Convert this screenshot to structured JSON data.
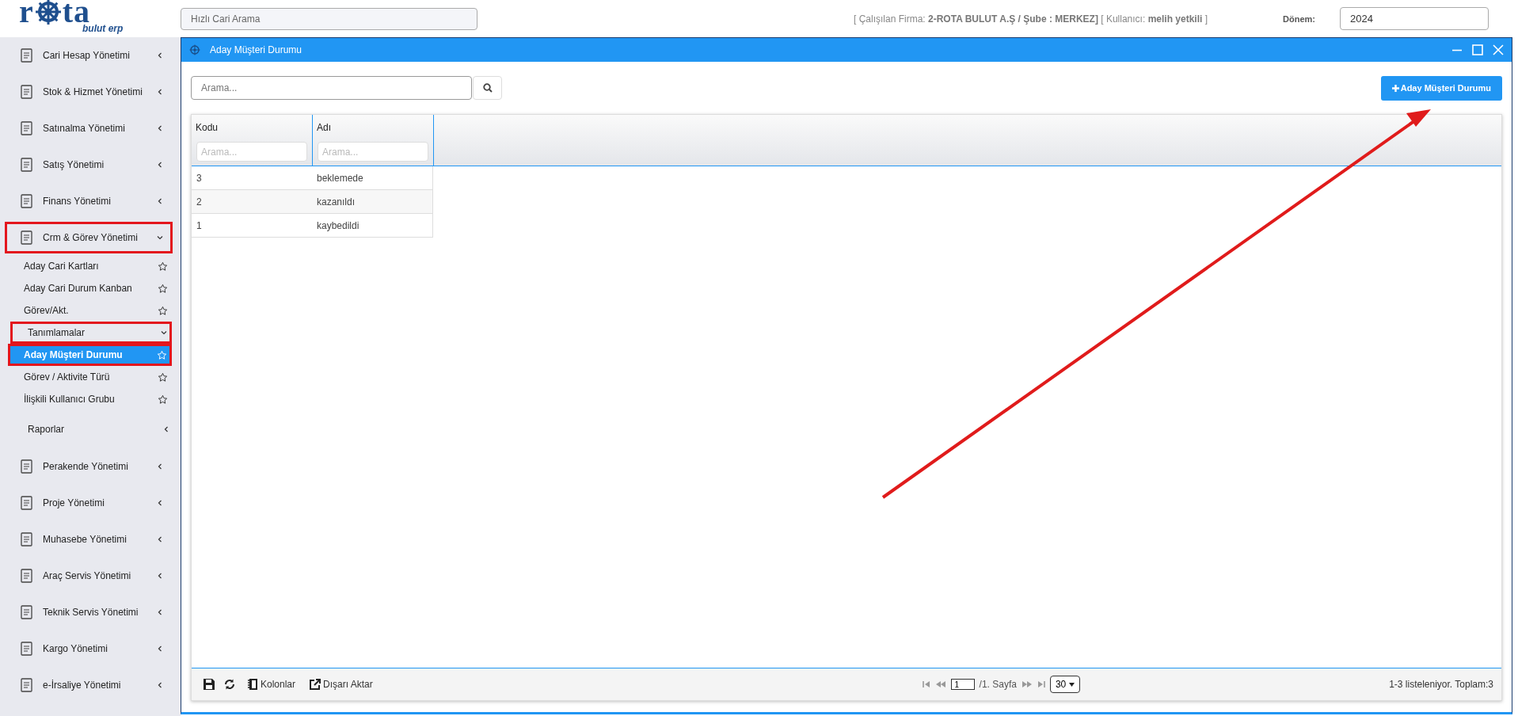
{
  "header": {
    "logo": {
      "before": "r",
      "after": "ta",
      "tagline": "bulut erp"
    },
    "quick_search": {
      "placeholder": "Hızlı Cari Arama"
    },
    "session_info": "[ Çalışılan Firma: **2-ROTA BULUT A.Ş / Şube : MERKEZ]** [ Kullanıcı: **melih yetkili** ]",
    "period": {
      "label": "Dönem:",
      "value": "2024"
    }
  },
  "sidebar": {
    "items": [
      {
        "label": "Cari Hesap Yönetimi",
        "kind": "module",
        "expanded": false,
        "highlighted": false
      },
      {
        "label": "Stok & Hizmet Yönetimi",
        "kind": "module",
        "expanded": false,
        "highlighted": false
      },
      {
        "label": "Satınalma Yönetimi",
        "kind": "module",
        "expanded": false,
        "highlighted": false
      },
      {
        "label": "Satış Yönetimi",
        "kind": "module",
        "expanded": false,
        "highlighted": false
      },
      {
        "label": "Finans Yönetimi",
        "kind": "module",
        "expanded": false,
        "highlighted": false
      },
      {
        "label": "Crm & Görev Yönetimi",
        "kind": "module",
        "expanded": true,
        "highlighted": true,
        "children": [
          {
            "label": "Aday Cari Kartları",
            "kind": "link",
            "selected": false,
            "highlighted": false
          },
          {
            "label": "Aday Cari Durum Kanban",
            "kind": "link",
            "selected": false,
            "highlighted": false
          },
          {
            "label": "Görev/Akt.",
            "kind": "link",
            "selected": false,
            "highlighted": false
          },
          {
            "label": "Tanımlamalar",
            "kind": "group",
            "expanded": true,
            "highlighted": true,
            "children": [
              {
                "label": "Aday Müşteri Durumu",
                "kind": "link",
                "selected": true,
                "highlighted": true
              },
              {
                "label": "Görev / Aktivite Türü",
                "kind": "link",
                "selected": false,
                "highlighted": false
              },
              {
                "label": "İlişkili Kullanıcı Grubu",
                "kind": "link",
                "selected": false,
                "highlighted": false
              }
            ]
          },
          {
            "label": "Raporlar",
            "kind": "group",
            "expanded": false,
            "highlighted": false
          }
        ]
      },
      {
        "label": "Perakende Yönetimi",
        "kind": "module",
        "expanded": false,
        "highlighted": false
      },
      {
        "label": "Proje Yönetimi",
        "kind": "module",
        "expanded": false,
        "highlighted": false
      },
      {
        "label": "Muhasebe Yönetimi",
        "kind": "module",
        "expanded": false,
        "highlighted": false
      },
      {
        "label": "Araç Servis Yönetimi",
        "kind": "module",
        "expanded": false,
        "highlighted": false
      },
      {
        "label": "Teknik Servis Yönetimi",
        "kind": "module",
        "expanded": false,
        "highlighted": false
      },
      {
        "label": "Kargo Yönetimi",
        "kind": "module",
        "expanded": false,
        "highlighted": false
      },
      {
        "label": "e-İrsaliye Yönetimi",
        "kind": "module",
        "expanded": false,
        "highlighted": false
      }
    ]
  },
  "window": {
    "title": "Aday Müşteri Durumu",
    "search": {
      "placeholder": "Arama..."
    },
    "add_button": {
      "label": "Aday Müşteri Durumu"
    },
    "table": {
      "columns": [
        {
          "title": "Kodu",
          "filter_placeholder": "Arama..."
        },
        {
          "title": "Adı",
          "filter_placeholder": "Arama..."
        }
      ],
      "rows": [
        [
          "3",
          "beklemede"
        ],
        [
          "2",
          "kazanıldı"
        ],
        [
          "1",
          "kaybedildi"
        ]
      ]
    },
    "footer": {
      "tools": [
        "Kolonlar",
        "Dışarı Aktar"
      ],
      "page": "1",
      "page_label": "/1. Sayfa",
      "page_size": "30",
      "summary": "1-3 listeleniyor. Toplam:3"
    }
  }
}
